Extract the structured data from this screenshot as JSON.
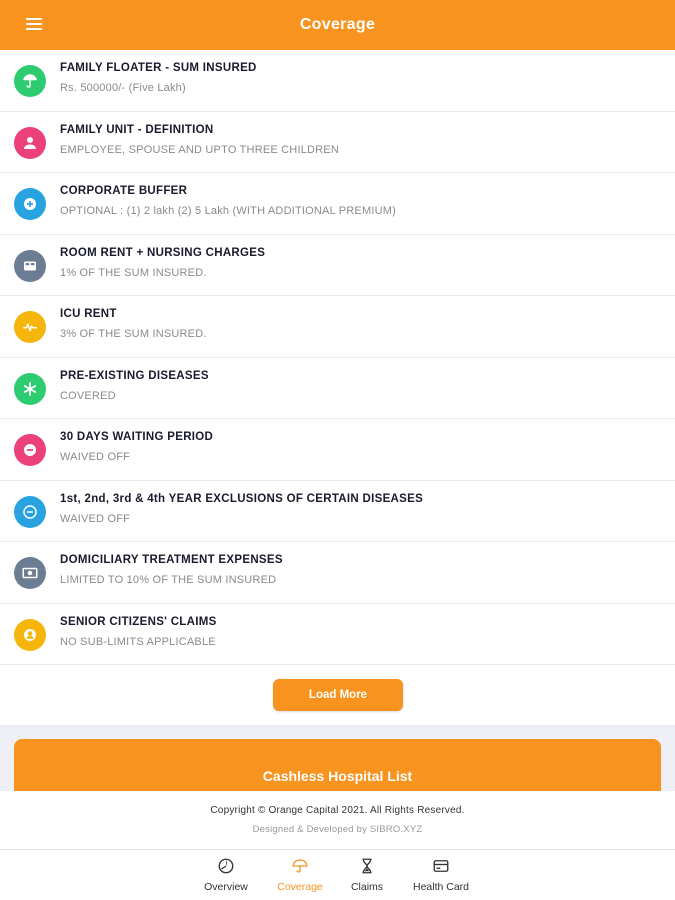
{
  "app": {
    "title": "Coverage",
    "accent_color": "#f7931e"
  },
  "coverage_items": [
    {
      "title": "FAMILY FLOATER - SUM INSURED",
      "subtitle": "Rs. 500000/- (Five Lakh)",
      "icon": "umbrella-icon",
      "color": "#2ecc71"
    },
    {
      "title": "FAMILY UNIT - DEFINITION",
      "subtitle": "EMPLOYEE, SPOUSE AND UPTO THREE CHILDREN",
      "icon": "person-icon",
      "color": "#ec407a"
    },
    {
      "title": "CORPORATE BUFFER",
      "subtitle": "OPTIONAL : (1) 2 lakh (2) 5 Lakh (WITH ADDITIONAL PREMIUM)",
      "icon": "plus-icon",
      "color": "#29a3e0"
    },
    {
      "title": "ROOM RENT + NURSING CHARGES",
      "subtitle": "1% OF THE SUM INSURED.",
      "icon": "bed-icon",
      "color": "#6b7c93"
    },
    {
      "title": "ICU RENT",
      "subtitle": "3% OF THE SUM INSURED.",
      "icon": "pulse-icon",
      "color": "#f5b50a"
    },
    {
      "title": "PRE-EXISTING DISEASES",
      "subtitle": "COVERED",
      "icon": "asterisk-icon",
      "color": "#2ecc71"
    },
    {
      "title": "30 DAYS WAITING PERIOD",
      "subtitle": "WAIVED OFF",
      "icon": "minus-icon",
      "color": "#ec407a"
    },
    {
      "title": "1st, 2nd, 3rd & 4th YEAR EXCLUSIONS OF CERTAIN DISEASES",
      "subtitle": "WAIVED OFF",
      "icon": "circle-minus-icon",
      "color": "#29a3e0"
    },
    {
      "title": "DOMICILIARY TREATMENT EXPENSES",
      "subtitle": "LIMITED TO 10% OF THE SUM INSURED",
      "icon": "money-icon",
      "color": "#6b7c93"
    },
    {
      "title": "SENIOR CITIZENS' CLAIMS",
      "subtitle": "NO SUB-LIMITS APPLICABLE",
      "icon": "senior-icon",
      "color": "#f5b50a"
    }
  ],
  "load_more_label": "Load More",
  "cashless_label": "Cashless Hospital List",
  "footer": {
    "copyright": "Copyright © Orange Capital 2021. All Rights Reserved.",
    "designed_by": "Designed & Developed by SIBRO.XYZ"
  },
  "bottom_nav": [
    {
      "label": "Overview",
      "icon": "clock-icon",
      "active": false
    },
    {
      "label": "Coverage",
      "icon": "umbrella-icon",
      "active": true
    },
    {
      "label": "Claims",
      "icon": "hourglass-icon",
      "active": false
    },
    {
      "label": "Health Card",
      "icon": "card-icon",
      "active": false
    }
  ]
}
